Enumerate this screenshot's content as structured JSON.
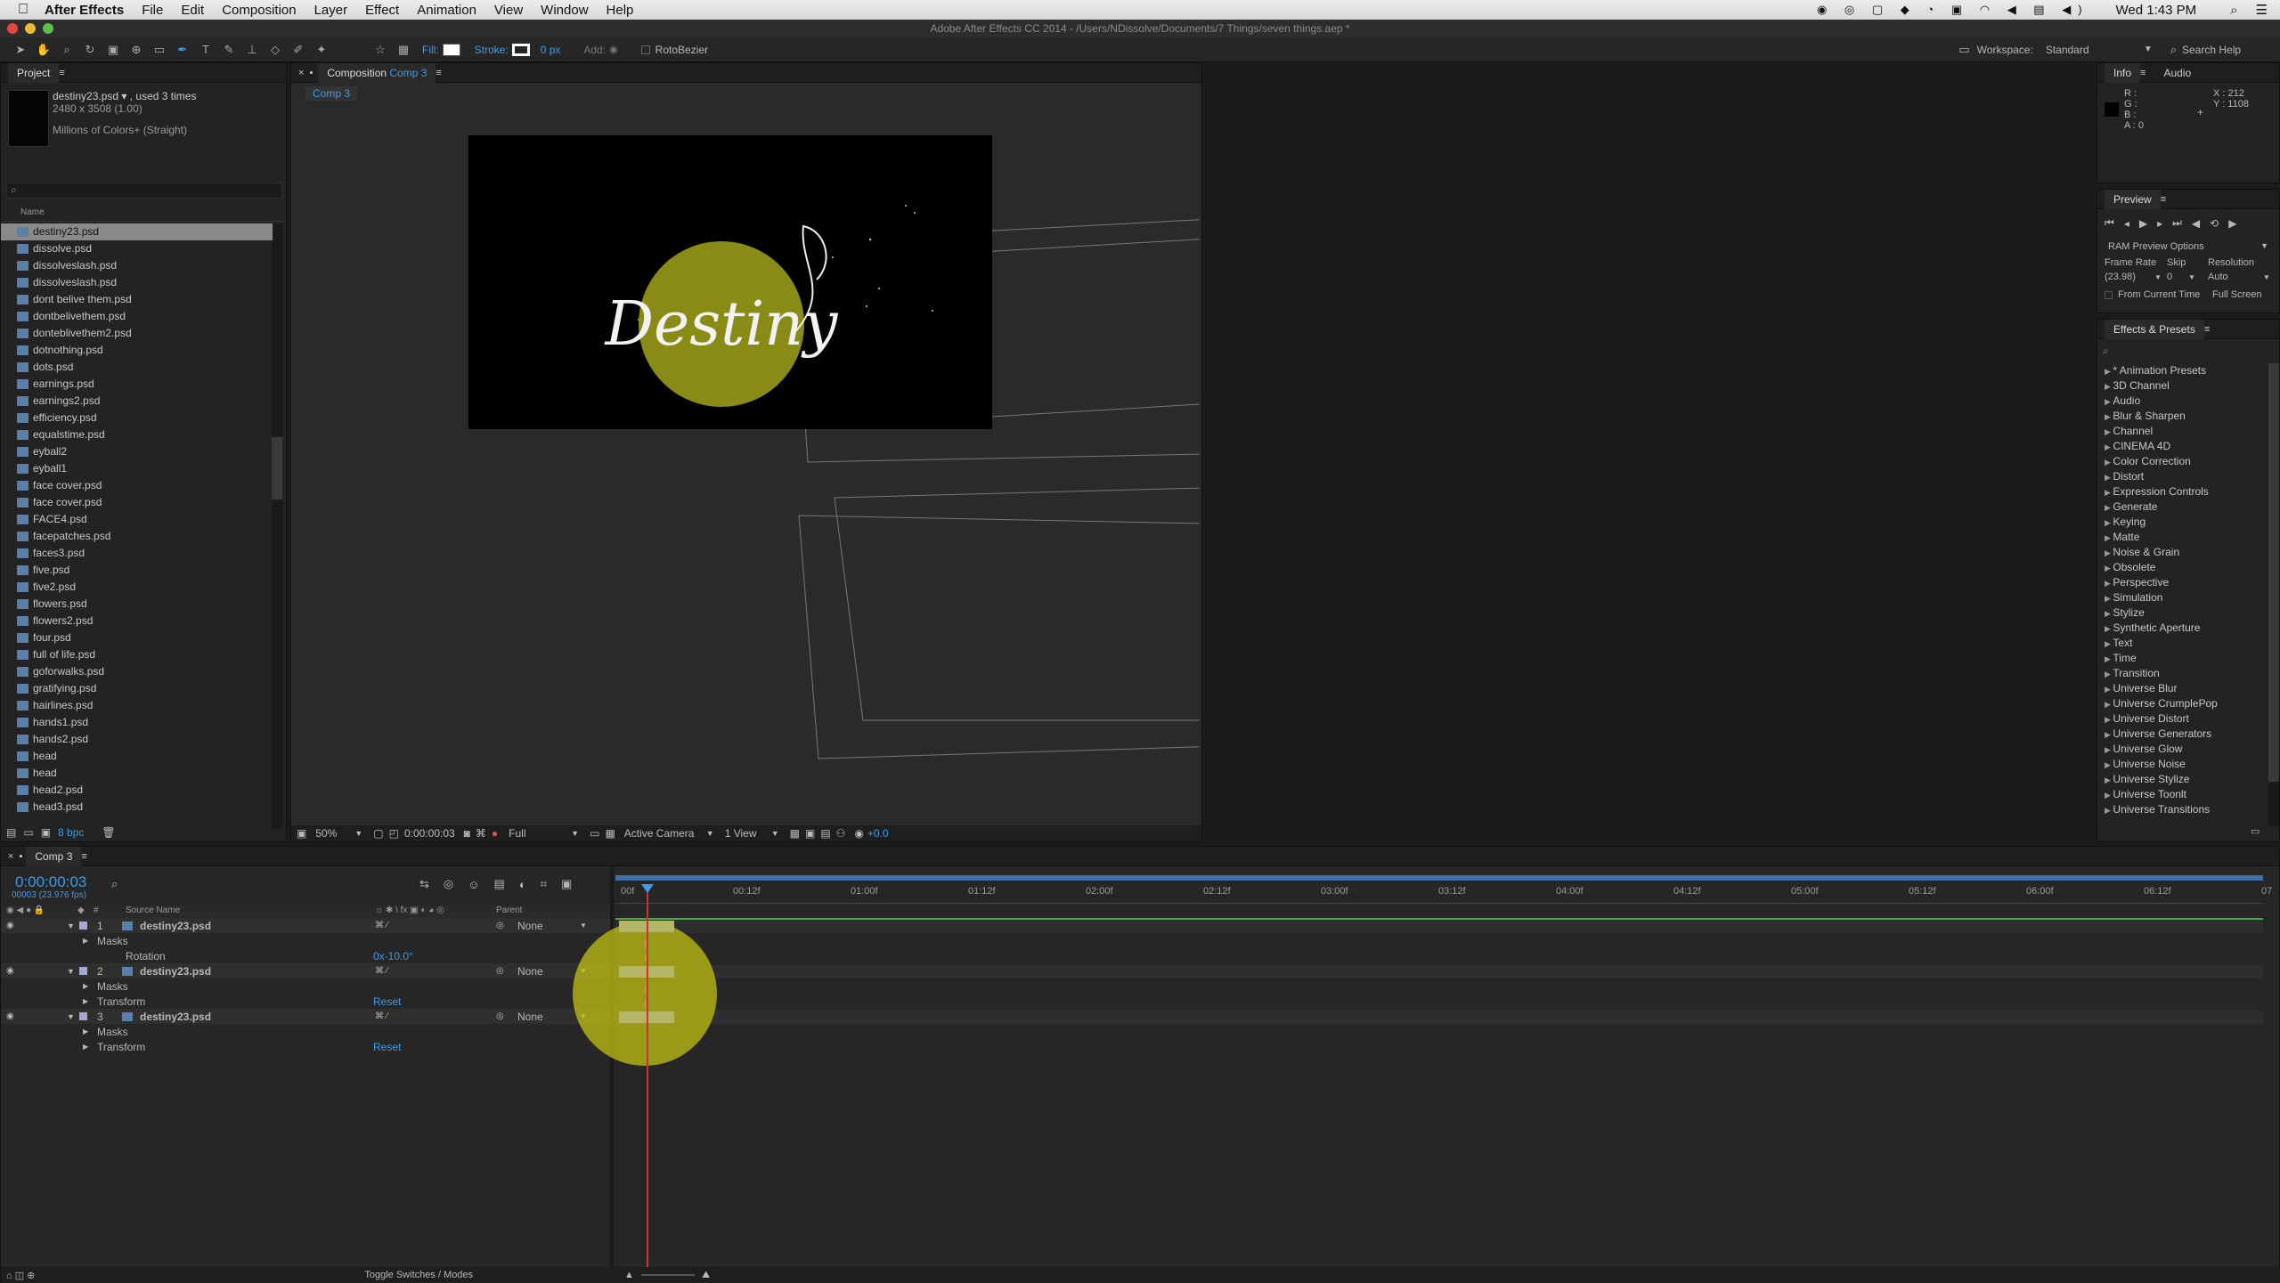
{
  "menubar": {
    "app_name": "After Effects",
    "items": [
      "File",
      "Edit",
      "Composition",
      "Layer",
      "Effect",
      "Animation",
      "View",
      "Window",
      "Help"
    ],
    "clock": "Wed 1:43 PM"
  },
  "window_title": "Adobe After Effects CC 2014 - /Users/NDissolve/Documents/7 Things/seven things.aep *",
  "toolbar": {
    "fill_label": "Fill:",
    "stroke_label": "Stroke:",
    "stroke_px": "0 px",
    "add_label": "Add:",
    "rotobezier": "RotoBezier",
    "workspace_label": "Workspace:",
    "workspace_value": "Standard",
    "search_help": "Search Help"
  },
  "project": {
    "tab": "Project",
    "asset_name": "destiny23.psd ▾ , used 3 times",
    "asset_dims": "2480 x 3508 (1.00)",
    "asset_colors": "Millions of Colors+ (Straight)",
    "col_name": "Name",
    "items": [
      "destiny23.psd",
      "dissolve.psd",
      "dissolveslash.psd",
      "dissolveslash.psd",
      "dont belive them.psd",
      "dontbelivethem.psd",
      "donteblivethem2.psd",
      "dotnothing.psd",
      "dots.psd",
      "earnings.psd",
      "earnings2.psd",
      "efficiency.psd",
      "equalstime.psd",
      "eyball2",
      "eyball1",
      "face cover.psd",
      "face cover.psd",
      "FACE4.psd",
      "facepatches.psd",
      "faces3.psd",
      "five.psd",
      "five2.psd",
      "flowers.psd",
      "flowers2.psd",
      "four.psd",
      "full of life.psd",
      "goforwalks.psd",
      "gratifying.psd",
      "hairlines.psd",
      "hands1.psd",
      "hands2.psd",
      "head",
      "head",
      "head2.psd",
      "head3.psd"
    ],
    "bpc": "8 bpc"
  },
  "composition": {
    "tab_label": "Composition",
    "tab_comp": "Comp 3",
    "breadcrumb": "Comp 3",
    "canvas_text": "Destiny",
    "zoom": "50%",
    "timecode": "0:00:00:03",
    "resolution": "Full",
    "camera": "Active Camera",
    "views": "1 View",
    "exposure": "+0.0"
  },
  "info": {
    "tab_info": "Info",
    "tab_audio": "Audio",
    "r": "R :",
    "g": "G :",
    "b": "B :",
    "a": "A : 0",
    "x": "X : 212",
    "y": "Y : 1108"
  },
  "preview": {
    "tab": "Preview",
    "options": "RAM Preview Options",
    "frame_rate_label": "Frame Rate",
    "skip_label": "Skip",
    "resolution_label": "Resolution",
    "frame_rate": "(23.98)",
    "skip": "0",
    "resolution": "Auto",
    "from_current": "From Current Time",
    "full_screen": "Full Screen"
  },
  "effects": {
    "tab": "Effects & Presets",
    "items": [
      "* Animation Presets",
      "3D Channel",
      "Audio",
      "Blur & Sharpen",
      "Channel",
      "CINEMA 4D",
      "Color Correction",
      "Distort",
      "Expression Controls",
      "Generate",
      "Keying",
      "Matte",
      "Noise & Grain",
      "Obsolete",
      "Perspective",
      "Simulation",
      "Stylize",
      "Synthetic Aperture",
      "Text",
      "Time",
      "Transition",
      "Universe Blur",
      "Universe CrumplePop",
      "Universe Distort",
      "Universe Generators",
      "Universe Glow",
      "Universe Noise",
      "Universe Stylize",
      "Universe Toonlt",
      "Universe Transitions"
    ]
  },
  "timeline": {
    "tab": "Comp 3",
    "timecode": "0:00:00:03",
    "frames": "00003 (23.976 fps)",
    "col_source": "Source Name",
    "col_parent": "Parent",
    "ruler": [
      "00f",
      "00:12f",
      "01:00f",
      "01:12f",
      "02:00f",
      "02:12f",
      "03:00f",
      "03:12f",
      "04:00f",
      "04:12f",
      "05:00f",
      "05:12f",
      "06:00f",
      "06:12f",
      "07"
    ],
    "layers": [
      {
        "num": "1",
        "name": "destiny23.psd",
        "parent": "None"
      },
      {
        "num": "2",
        "name": "destiny23.psd",
        "parent": "None"
      },
      {
        "num": "3",
        "name": "destiny23.psd",
        "parent": "None"
      }
    ],
    "masks": "Masks",
    "rotation": "Rotation",
    "rotation_value": "0x-10.0°",
    "transform": "Transform",
    "reset": "Reset",
    "toggle": "Toggle Switches / Modes"
  }
}
